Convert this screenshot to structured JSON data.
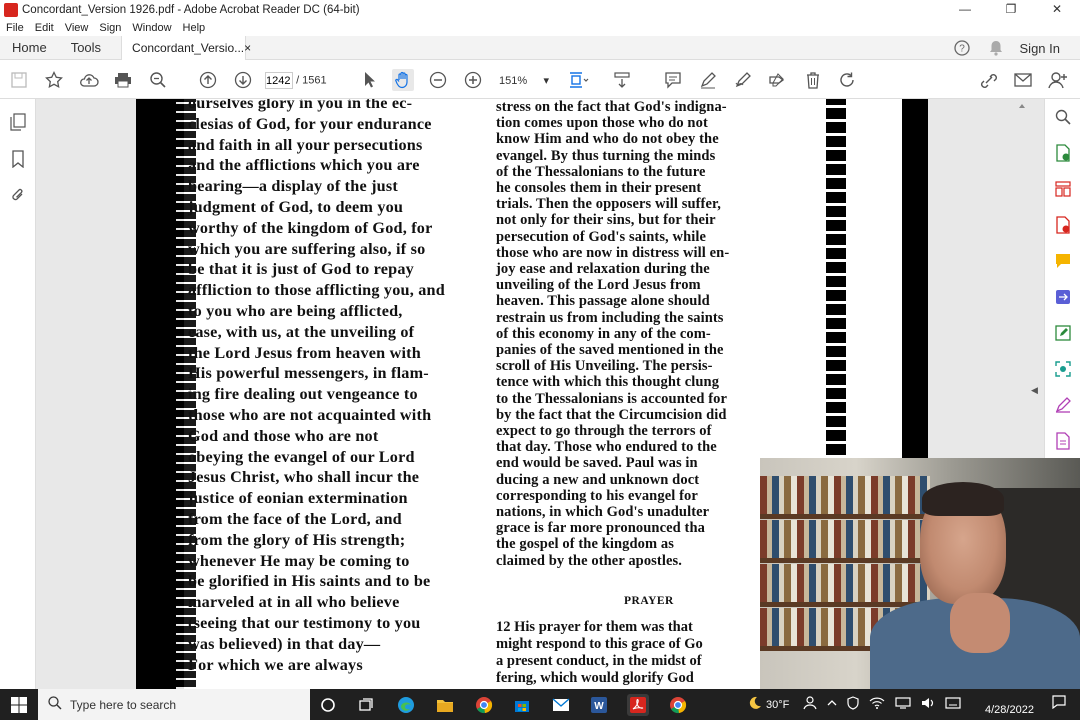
{
  "window": {
    "title": "Concordant_Version 1926.pdf - Adobe Acrobat Reader DC (64-bit)",
    "minimize": "—",
    "maximize": "❐",
    "close": "✕"
  },
  "menu": [
    "File",
    "Edit",
    "View",
    "Sign",
    "Window",
    "Help"
  ],
  "tabs": {
    "home": "Home",
    "tools": "Tools",
    "document": "Concordant_Versio...",
    "close": "×",
    "sign_in": "Sign In"
  },
  "toolbar": {
    "page_current": "1242",
    "page_total": "/ 1561",
    "zoom": "151%",
    "zoom_caret": "▾"
  },
  "document": {
    "col1": [
      "ourselves glory in you in the ec-",
      "clesias of God, for your endurance",
      "and faith in all your persecutions",
      "and the afflictions which you are",
      "bearing—a display of the just",
      "judgment of God, to deem you",
      "worthy of the kingdom of God, for",
      "which you are suffering also, if so",
      "be that it is just of God to repay",
      "affliction to those afflicting you, and",
      "to you who are being afflicted,",
      "ease, with us, at the unveiling of",
      "the Lord Jesus from heaven with",
      "His powerful messengers, in flam-",
      "ing fire dealing out vengeance to",
      "those who are not acquainted with",
      "God and those who are not",
      "obeying the evangel of our Lord",
      "Jesus Christ, who shall incur the",
      "justice of eonian extermination",
      "from the face of the Lord, and",
      "from the glory of His strength;",
      "whenever He may be coming to",
      "be glorified in His saints and to be",
      "marveled at in all who believe",
      "(seeing that our testimony to you",
      "was believed) in that day—",
      "For which we are always"
    ],
    "col2": [
      "stress on the fact that God's indigna-",
      "tion comes upon those who do not",
      "know Him and who do not obey the",
      "evangel. By thus turning the minds",
      "of the Thessalonians to the future",
      "he consoles them in their present",
      "trials. Then the opposers will suffer,",
      "not only for their sins, but for their",
      "persecution of God's saints, while",
      "those who are now in distress will en-",
      "joy ease and relaxation during the",
      "unveiling of the Lord Jesus from",
      "heaven. This passage alone should",
      "restrain us from including the saints",
      "of this economy in any of the com-",
      "panies of the saved mentioned in the",
      "scroll of His Unveiling. The persis-",
      "tence with which this thought clung",
      "to the Thessalonians is accounted for",
      "by the fact that the Circumcision did",
      "expect to go through the terrors of",
      "that day. Those who endured to the",
      "end would be saved. Paul was in",
      "ducing a new and unknown doct",
      "corresponding to his evangel for",
      "nations, in which God's unadulter",
      "grace is far more pronounced tha",
      "the gospel of the kingdom as",
      "claimed by the other apostles."
    ],
    "prayer_heading": "PRAYER",
    "col2b": [
      "12 His prayer for them was that",
      "might respond to this grace of Go",
      "a present conduct, in the midst of",
      "fering, which would glorify God"
    ]
  },
  "taskbar": {
    "search_placeholder": "Type here to search",
    "weather": "30°F",
    "time": "",
    "date": "4/28/2022"
  },
  "colors": {
    "acrobat_red": "#d7261e",
    "taskbar": "#202020"
  }
}
